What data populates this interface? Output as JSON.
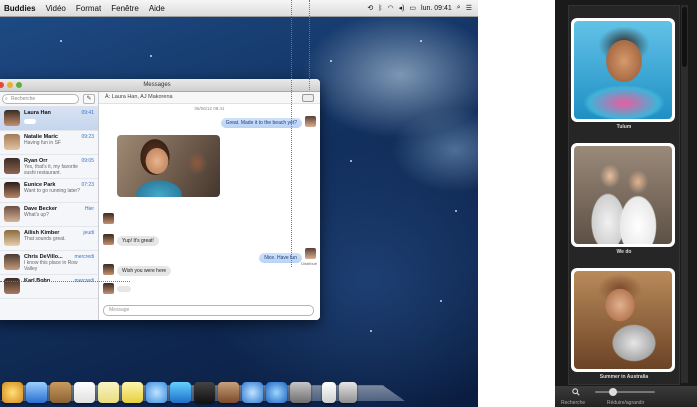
{
  "menubar": {
    "items": [
      "Buddies",
      "Vidéo",
      "Format",
      "Fenêtre",
      "Aide"
    ],
    "clock": "lun. 09:41"
  },
  "messages": {
    "window_title": "Messages",
    "search_placeholder": "Recherche",
    "to_line": "À:  Laura Han,  AJ Makorena",
    "timestamp": "06/06/12 08:41",
    "conversations": [
      {
        "name": "Laura Han",
        "time": "09:41",
        "preview": "",
        "selected": true
      },
      {
        "name": "Natalie Maric",
        "time": "09:23",
        "preview": "Having fun in SF",
        "selected": false
      },
      {
        "name": "Ryan Orr",
        "time": "09:05",
        "preview": "Yes, that's it, my favorite sushi restaurant.",
        "selected": false
      },
      {
        "name": "Eunice Park",
        "time": "07:23",
        "preview": "Want to go running later?",
        "selected": false
      },
      {
        "name": "Dave Becker",
        "time": "Hier",
        "preview": "What's up?",
        "selected": false
      },
      {
        "name": "Ailish Kimber",
        "time": "jeudi",
        "preview": "That sounds great.",
        "selected": false
      },
      {
        "name": "Chris DeVillo...",
        "time": "mercredi",
        "preview": "I know this place in Row Valley",
        "selected": false
      },
      {
        "name": "Karl Bohn",
        "time": "mercredi",
        "preview": "",
        "selected": false
      }
    ],
    "bubbles": {
      "out1": "Great. Made it to the beach yet?",
      "in1": "Yup! It's great!",
      "out2": "Nice. Have fun",
      "in2": "Wish you were here"
    },
    "signature": "Distribué",
    "input_placeholder": "Message"
  },
  "photobooth": {
    "photos": [
      {
        "caption": "Tulum"
      },
      {
        "caption": "We do"
      },
      {
        "caption": "Summer in Australia"
      }
    ],
    "search_label": "Recherche",
    "zoom_label": "Réduire/agrandir"
  }
}
